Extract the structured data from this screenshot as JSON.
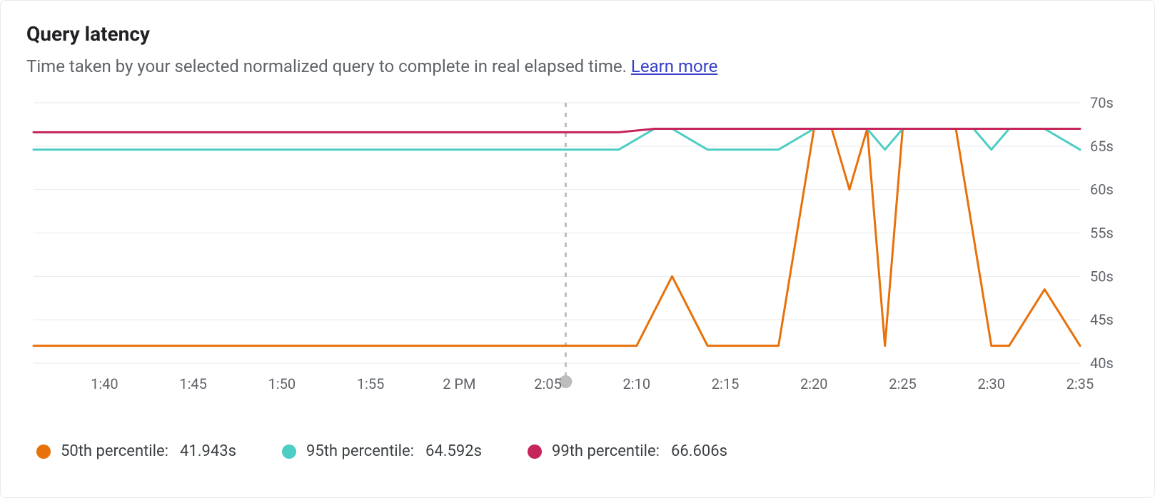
{
  "title": "Query latency",
  "subtitle_text": "Time taken by your selected normalized query to complete in real elapsed time. ",
  "learn_more": "Learn more",
  "colors": {
    "p50": "#e8710a",
    "p95": "#4ecdc4",
    "p99": "#c5255a",
    "grid": "#e8eaed",
    "axis_text": "#5f6368",
    "cursor": "#bdbdbd"
  },
  "legend": [
    {
      "key": "p50",
      "label": "50th percentile:",
      "value": "41.943s"
    },
    {
      "key": "p95",
      "label": "95th percentile:",
      "value": "64.592s"
    },
    {
      "key": "p99",
      "label": "99th percentile:",
      "value": "66.606s"
    }
  ],
  "chart_data": {
    "type": "line",
    "title": "Query latency",
    "xlabel": "",
    "ylabel": "",
    "ylim": [
      40,
      70
    ],
    "y_ticks": [
      40,
      45,
      50,
      55,
      60,
      65,
      70
    ],
    "y_tick_suffix": "s",
    "x_minutes_range": [
      96,
      155
    ],
    "x_ticks": [
      {
        "m": 100,
        "label": "1:40"
      },
      {
        "m": 105,
        "label": "1:45"
      },
      {
        "m": 110,
        "label": "1:50"
      },
      {
        "m": 115,
        "label": "1:55"
      },
      {
        "m": 120,
        "label": "2 PM"
      },
      {
        "m": 125,
        "label": "2:05"
      },
      {
        "m": 130,
        "label": "2:10"
      },
      {
        "m": 135,
        "label": "2:15"
      },
      {
        "m": 140,
        "label": "2:20"
      },
      {
        "m": 145,
        "label": "2:25"
      },
      {
        "m": 150,
        "label": "2:30"
      },
      {
        "m": 155,
        "label": "2:35"
      }
    ],
    "cursor_x_minutes": 126,
    "series": [
      {
        "name": "50th percentile",
        "key": "p50",
        "points": [
          {
            "m": 96,
            "v": 42
          },
          {
            "m": 130,
            "v": 42
          },
          {
            "m": 132,
            "v": 50
          },
          {
            "m": 134,
            "v": 42
          },
          {
            "m": 138,
            "v": 42
          },
          {
            "m": 140,
            "v": 67
          },
          {
            "m": 141,
            "v": 67
          },
          {
            "m": 142,
            "v": 60
          },
          {
            "m": 143,
            "v": 67
          },
          {
            "m": 144,
            "v": 42
          },
          {
            "m": 145,
            "v": 67
          },
          {
            "m": 148,
            "v": 67
          },
          {
            "m": 150,
            "v": 42
          },
          {
            "m": 151,
            "v": 42
          },
          {
            "m": 153,
            "v": 48.5
          },
          {
            "m": 155,
            "v": 42
          }
        ]
      },
      {
        "name": "95th percentile",
        "key": "p95",
        "points": [
          {
            "m": 96,
            "v": 64.6
          },
          {
            "m": 129,
            "v": 64.6
          },
          {
            "m": 131,
            "v": 67
          },
          {
            "m": 132,
            "v": 67
          },
          {
            "m": 134,
            "v": 64.6
          },
          {
            "m": 138,
            "v": 64.6
          },
          {
            "m": 140,
            "v": 67
          },
          {
            "m": 143,
            "v": 67
          },
          {
            "m": 144,
            "v": 64.6
          },
          {
            "m": 145,
            "v": 67
          },
          {
            "m": 149,
            "v": 67
          },
          {
            "m": 150,
            "v": 64.6
          },
          {
            "m": 151,
            "v": 67
          },
          {
            "m": 153,
            "v": 67
          },
          {
            "m": 155,
            "v": 64.6
          }
        ]
      },
      {
        "name": "99th percentile",
        "key": "p99",
        "points": [
          {
            "m": 96,
            "v": 66.6
          },
          {
            "m": 129,
            "v": 66.6
          },
          {
            "m": 131,
            "v": 67
          },
          {
            "m": 155,
            "v": 67
          }
        ]
      }
    ]
  }
}
